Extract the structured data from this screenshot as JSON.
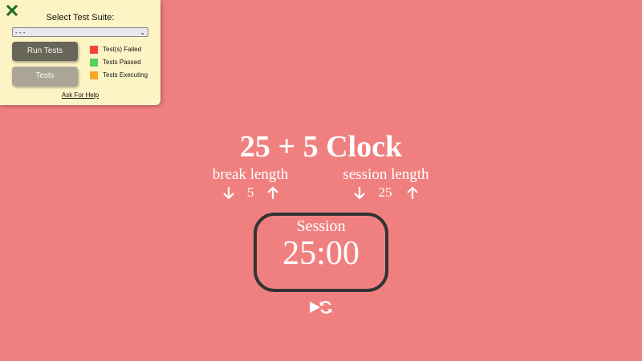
{
  "test_panel": {
    "title": "Select Test Suite:",
    "select_value": "- - -",
    "run_tests_label": "Run Tests",
    "tests_label": "Tests",
    "legend": [
      {
        "label": "Test(s) Failed",
        "color": "#f44336"
      },
      {
        "label": "Tests Passed",
        "color": "#5ad15a"
      },
      {
        "label": "Tests Executing",
        "color": "#f5a623"
      }
    ],
    "help_link": "Ask For Help",
    "close_icon": "close-x-icon",
    "close_color": "#1f6b1f"
  },
  "clock": {
    "title": "25 + 5 Clock",
    "break_label": "break length",
    "break_length": "5",
    "session_label": "session length",
    "session_length": "25",
    "timer_label": "Session",
    "time_left": "25:00",
    "background_color": "#f08080",
    "border_color": "#333333"
  }
}
